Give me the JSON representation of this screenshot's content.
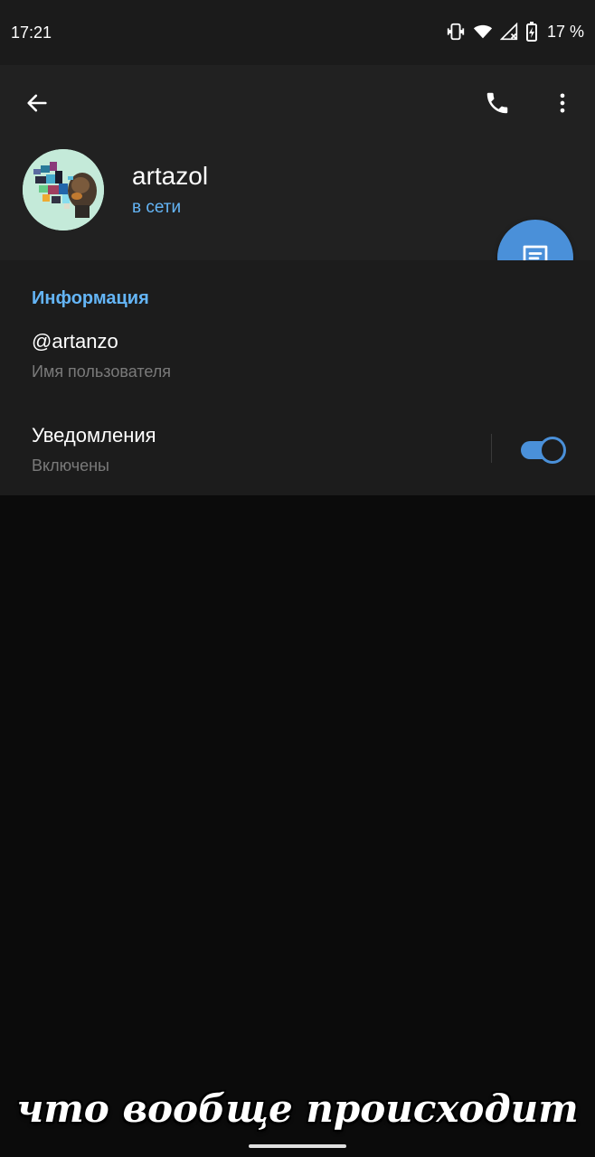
{
  "status_bar": {
    "time": "17:21",
    "battery": "17 %",
    "icons": [
      "vibrate-icon",
      "wifi-icon",
      "no-signal-icon",
      "battery-charging-icon"
    ]
  },
  "toolbar": {
    "back_icon": "arrow-left-icon",
    "call_icon": "phone-icon",
    "menu_icon": "more-vertical-icon"
  },
  "profile": {
    "name": "artazol",
    "status": "в сети",
    "fab_icon": "message-icon"
  },
  "info": {
    "title": "Информация",
    "username_value": "@artanzo",
    "username_label": "Имя пользователя",
    "notifications_title": "Уведомления",
    "notifications_sub": "Включены",
    "notifications_enabled": true
  },
  "caption": "что вообще происходит",
  "colors": {
    "accent": "#4a90d9",
    "link": "#64b5f6",
    "header_bg": "#212121",
    "section_bg": "#1c1c1c",
    "page_bg": "#0b0b0b"
  }
}
